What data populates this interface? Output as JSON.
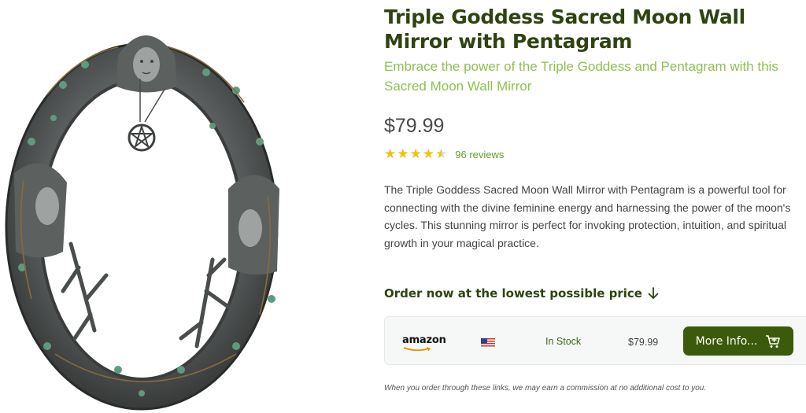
{
  "product": {
    "title": "Triple Goddess Sacred Moon Wall Mirror with Pentagram",
    "subtitle": "Embrace the power of the Triple Goddess and Pentagram with this Sacred Moon Wall Mirror",
    "price": "$79.99",
    "rating": 4.5,
    "reviews": "96 reviews",
    "description": "The Triple Goddess Sacred Moon Wall Mirror with Pentagram is a powerful tool for connecting with the divine feminine energy and harnessing the power of the moon's cycles. This stunning mirror is perfect for invoking protection, intuition, and spiritual growth in your magical practice."
  },
  "order": {
    "heading": "Order now at the lowest possible price",
    "offers": [
      {
        "store": "amazon",
        "country_flag": "us-flag-icon",
        "stock": "In Stock",
        "price": "$79.99",
        "button_label": "More Info..."
      }
    ]
  },
  "disclaimer": "When you order through these links, we may earn a commission at no additional cost to you.",
  "colors": {
    "title": "#2f4310",
    "subtitle": "#8fc050",
    "star": "#f2c10f",
    "button": "#3b5a0b"
  }
}
